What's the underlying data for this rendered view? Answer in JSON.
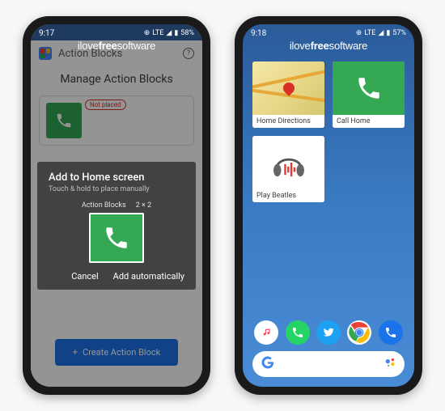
{
  "watermark": {
    "t1": "ilove",
    "t2": "free",
    "t3": "software"
  },
  "left": {
    "status": {
      "time": "9:17",
      "network": "LTE",
      "battery": "58%"
    },
    "header": {
      "title": "Action Blocks",
      "help": "?"
    },
    "manage_title": "Manage Action Blocks",
    "preview": {
      "not_placed": "Not placed"
    },
    "dialog": {
      "title": "Add to Home screen",
      "subtitle": "Touch & hold to place manually",
      "widget_name": "Action Blocks",
      "widget_size": "2 × 2",
      "cancel": "Cancel",
      "add": "Add automatically"
    },
    "create_btn": "Create Action Block"
  },
  "right": {
    "status": {
      "time": "9:18",
      "network": "LTE",
      "battery": "57%"
    },
    "widgets": {
      "home_dir": "Home Directions",
      "call_home": "Call Home",
      "play_beatles": "Play Beatles"
    },
    "search": {
      "logo": "G"
    }
  },
  "icons": {
    "signal": "▲",
    "plus": "+"
  }
}
